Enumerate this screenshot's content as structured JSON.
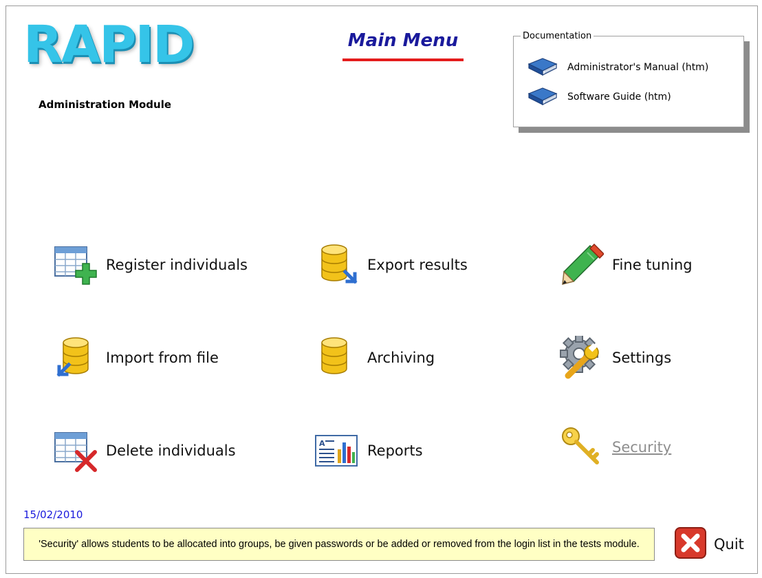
{
  "app": {
    "logo_text": "RAPID",
    "module_label": "Administration Module",
    "title": "Main Menu"
  },
  "documentation": {
    "legend": "Documentation",
    "items": [
      {
        "label": "Administrator's Manual (htm)",
        "icon": "book-icon"
      },
      {
        "label": "Software Guide (htm)",
        "icon": "book-icon"
      }
    ]
  },
  "menu": {
    "register": {
      "label": "Register individuals",
      "icon": "table-add-icon"
    },
    "import": {
      "label": "Import from file",
      "icon": "database-import-icon"
    },
    "delete": {
      "label": "Delete individuals",
      "icon": "table-delete-icon"
    },
    "export": {
      "label": "Export results",
      "icon": "database-export-icon"
    },
    "archiving": {
      "label": "Archiving",
      "icon": "database-icon"
    },
    "reports": {
      "label": "Reports",
      "icon": "report-chart-icon"
    },
    "fine_tuning": {
      "label": "Fine tuning",
      "icon": "pencil-icon"
    },
    "settings": {
      "label": "Settings",
      "icon": "gear-wrench-icon"
    },
    "security": {
      "label": "Security",
      "icon": "keys-icon",
      "disabled": true
    }
  },
  "status": {
    "date": "15/02/2010",
    "message": "'Security' allows students to be allocated into groups, be given passwords or be added or removed from the login list in the tests module."
  },
  "quit": {
    "label": "Quit",
    "icon": "close-icon"
  },
  "colors": {
    "logo": "#35c4e8",
    "title": "#1a1a9c",
    "title_underline": "#e41c1c",
    "date": "#1a1adc",
    "status_bg": "#ffffc4",
    "quit": "#d8392b"
  }
}
